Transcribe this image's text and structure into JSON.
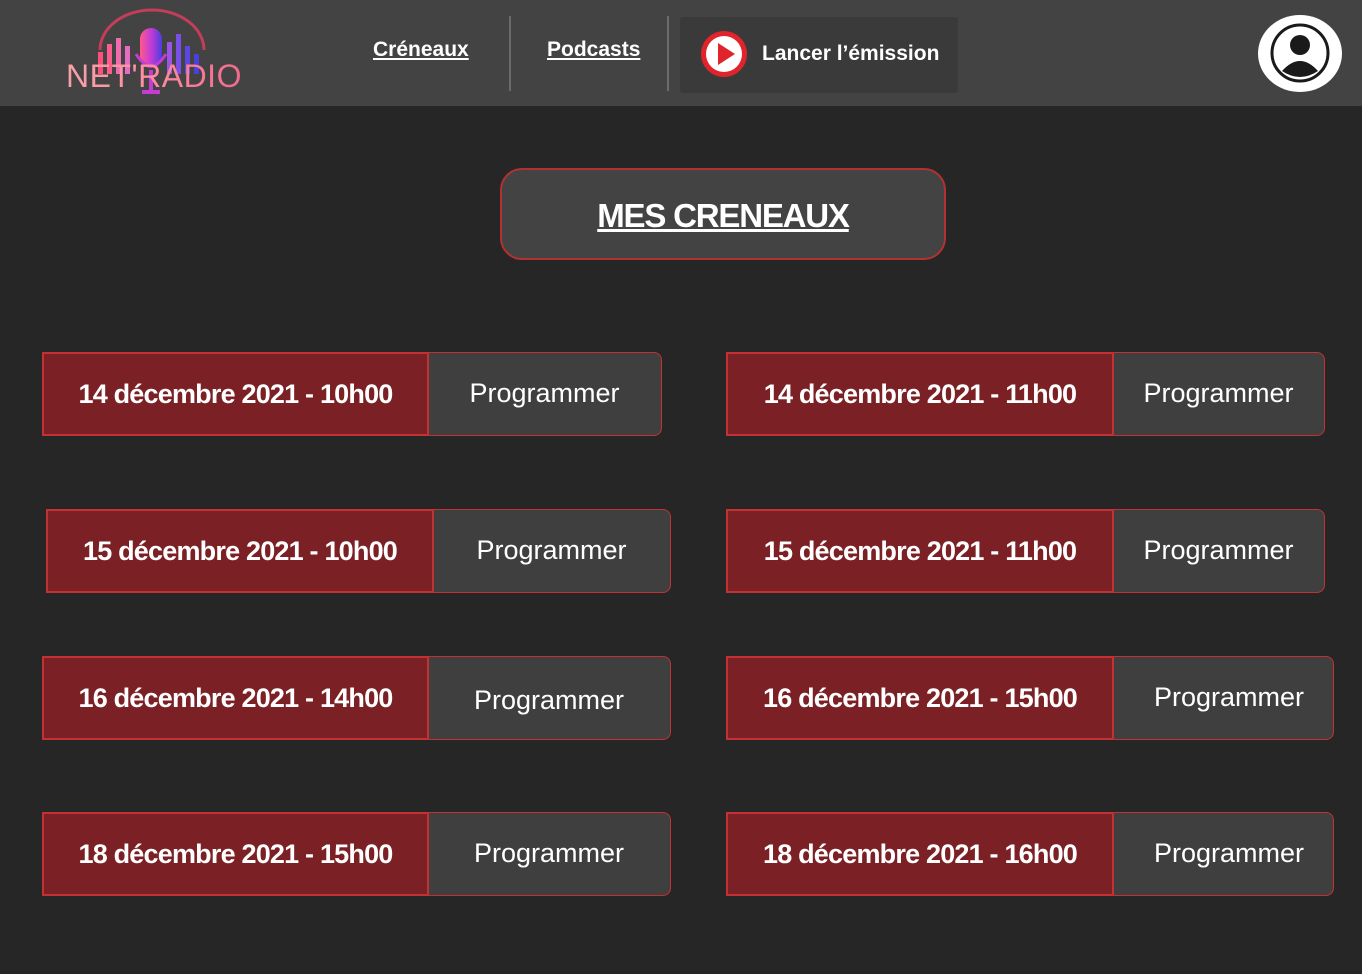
{
  "header": {
    "logo_text": "NET'RADIO",
    "logo_icon": "microphone-equalizer-icon",
    "nav": {
      "creneaux": "Créneaux",
      "podcasts": "Podcasts"
    },
    "launch_label": "Lancer l’émission",
    "launch_icon": "play-icon",
    "avatar_icon": "user-icon"
  },
  "colors": {
    "background": "#262626",
    "header": "#434343",
    "accent_red": "#c23234",
    "slot_red": "#7b2024",
    "button_dark": "#3f3f3f",
    "play_red": "#e0242b"
  },
  "title": "MES CRENEAUX",
  "slots": [
    {
      "label": "14 décembre 2021 - 10h00",
      "action": "Programmer"
    },
    {
      "label": "14 décembre 2021 - 11h00",
      "action": "Programmer"
    },
    {
      "label": "15 décembre 2021 - 10h00",
      "action": "Programmer"
    },
    {
      "label": "15 décembre 2021 - 11h00",
      "action": "Programmer"
    },
    {
      "label": "16 décembre 2021 - 14h00",
      "action": "Programmer"
    },
    {
      "label": "16 décembre 2021 - 15h00",
      "action": "Programmer"
    },
    {
      "label": "18 décembre 2021 - 15h00",
      "action": "Programmer"
    },
    {
      "label": "18 décembre 2021 - 16h00",
      "action": "Programmer"
    }
  ]
}
